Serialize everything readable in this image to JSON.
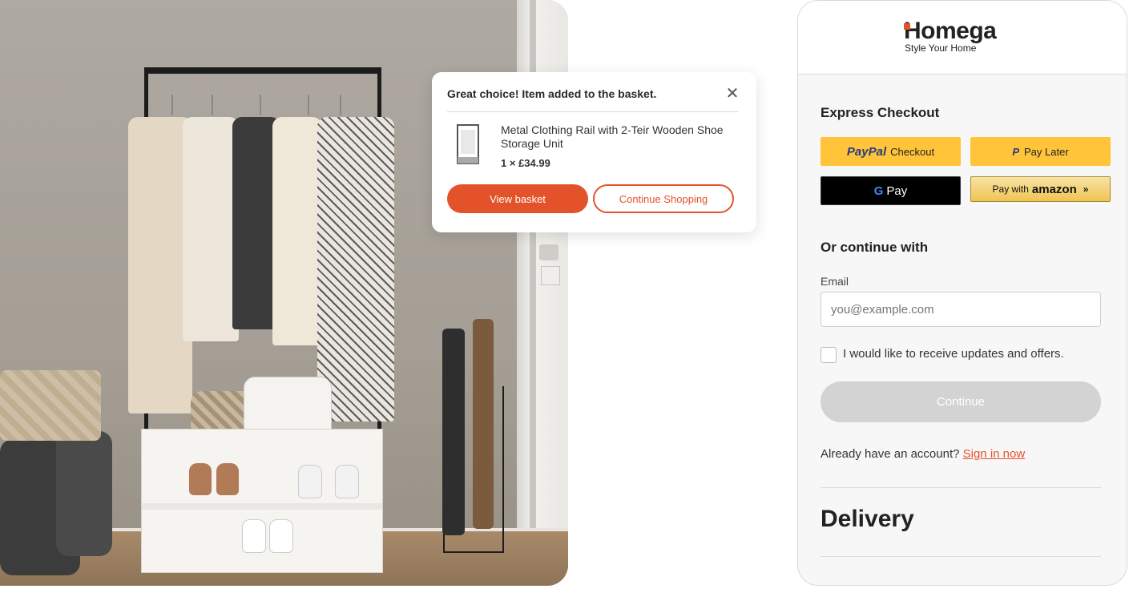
{
  "toast": {
    "message": "Great choice! Item added to the basket.",
    "close_icon": "close-icon",
    "product_name": "Metal Clothing Rail with 2-Teir Wooden Shoe Storage Unit",
    "quantity_price": "1 × £34.99",
    "view_basket_label": "View basket",
    "continue_shopping_label": "Continue Shopping"
  },
  "brand": {
    "name": "Homega",
    "tagline": "Style Your Home",
    "accent_color": "#e4522a"
  },
  "express": {
    "title": "Express Checkout",
    "paypal_brand": "PayPal",
    "paypal_checkout_label": "Checkout",
    "paylater_label": "Pay Later",
    "gpay_label": "Pay",
    "amazon_label_prefix": "Pay with",
    "amazon_brand": "amazon"
  },
  "continue_with": {
    "title": "Or continue with",
    "email_label": "Email",
    "email_placeholder": "you@example.com",
    "updates_label": "I would like to receive updates and offers.",
    "continue_label": "Continue",
    "account_prompt": "Already have an account?",
    "sign_in_label": "Sign in now"
  },
  "delivery": {
    "title": "Delivery"
  }
}
